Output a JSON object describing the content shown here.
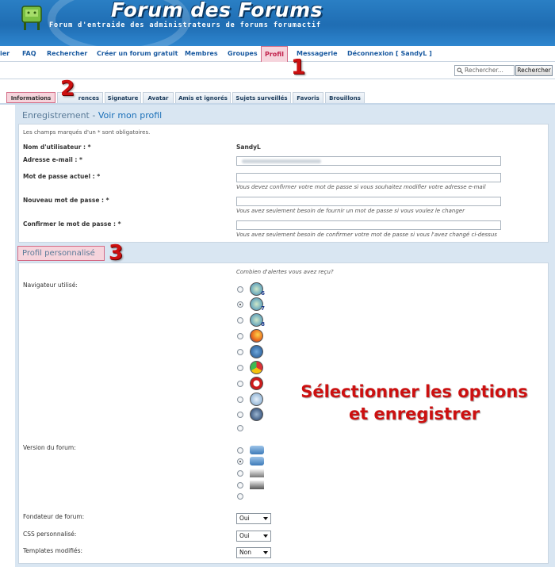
{
  "header": {
    "title": "Forum des Forums",
    "subtitle": "Forum d'entraide des administrateurs de forums forumactif"
  },
  "nav": {
    "items": [
      {
        "label": "ier"
      },
      {
        "label": "FAQ"
      },
      {
        "label": "Rechercher"
      },
      {
        "label": "Créer un forum gratuit"
      },
      {
        "label": "Membres"
      },
      {
        "label": "Groupes"
      },
      {
        "label": "Profil",
        "active": true
      },
      {
        "label": "Messagerie"
      },
      {
        "label": "Déconnexion [ SandyL ]"
      }
    ]
  },
  "search": {
    "placeholder": "Rechercher...",
    "button_label": "Rechercher"
  },
  "tabs": [
    {
      "label": "Informations",
      "active": true
    },
    {
      "label": "rences"
    },
    {
      "label": "Signature"
    },
    {
      "label": "Avatar"
    },
    {
      "label": "Amis et ignorés"
    },
    {
      "label": "Sujets surveillés"
    },
    {
      "label": "Favoris"
    },
    {
      "label": "Brouillons"
    }
  ],
  "registration": {
    "heading_prefix": "Enregistrement - ",
    "heading_link": "Voir mon profil",
    "required_note": "Les champs marqués d'un * sont obligatoires.",
    "username_label": "Nom d'utilisateur : *",
    "username_value": "SandyL",
    "email_label": "Adresse e-mail : *",
    "current_password_label": "Mot de passe actuel : *",
    "current_password_hint": "Vous devez confirmer votre mot de passe si vous souhaitez modifier votre adresse e-mail",
    "new_password_label": "Nouveau mot de passe : *",
    "new_password_hint": "Vous avez seulement besoin de fournir un mot de passe si vous voulez le changer",
    "confirm_password_label": "Confirmer le mot de passe : *",
    "confirm_password_hint": "Vous avez seulement besoin de confirmer votre mot de passe si vous l'avez changé ci-dessus"
  },
  "profile": {
    "heading": "Profil personnalisé",
    "alerts_question": "Combien d'alertes vous avez reçu?",
    "browser_label": "Navigateur utilisé:",
    "browser_options": [
      {
        "icon": "ie6-icon",
        "badge": "6",
        "selected": false
      },
      {
        "icon": "ie7-icon",
        "badge": "7",
        "selected": true
      },
      {
        "icon": "ie8-icon",
        "badge": "8",
        "selected": false
      },
      {
        "icon": "firefox-icon",
        "selected": false
      },
      {
        "icon": "netscape-icon",
        "selected": false
      },
      {
        "icon": "chrome-icon",
        "selected": false
      },
      {
        "icon": "opera-icon",
        "selected": false
      },
      {
        "icon": "safari-icon",
        "selected": false
      },
      {
        "icon": "navigator-icon",
        "selected": false
      },
      {
        "icon": "none",
        "selected": false
      }
    ],
    "version_label": "Version du forum:",
    "version_options": [
      {
        "icon": "phpbb2-icon",
        "selected": false
      },
      {
        "icon": "phpbb3-icon",
        "selected": true
      },
      {
        "icon": "punbb-icon",
        "selected": false
      },
      {
        "icon": "invision-icon",
        "selected": false
      },
      {
        "icon": "none",
        "selected": false
      }
    ],
    "founder_label": "Fondateur de forum:",
    "founder_value": "Oui",
    "css_label": "CSS personnalisé:",
    "css_value": "Oui",
    "templates_label": "Templates modifiés:",
    "templates_value": "Non"
  },
  "annotations": {
    "step1": "1",
    "step2": "2",
    "step3": "3",
    "instruction_line1": "Sélectionner les options",
    "instruction_line2": "et enregistrer"
  },
  "colors": {
    "accent_link": "#1a5aa0",
    "active_tab_bg": "#f6d4dc",
    "active_tab_border": "#d36b86",
    "annotation_red": "#cc1010",
    "panel_bg": "#d9e6f2"
  }
}
